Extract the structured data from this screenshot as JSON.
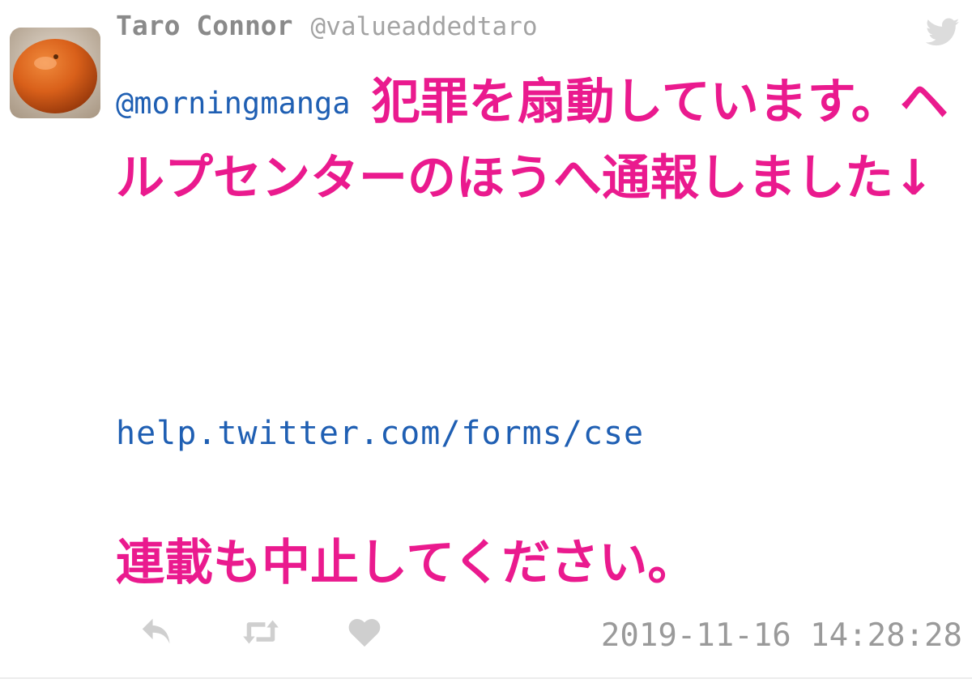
{
  "tweet": {
    "author_name": "Taro Connor",
    "author_handle": "@valueaddedtaro",
    "mention": "@morningmanga",
    "text_main": "犯罪を扇動しています。ヘルプセンターのほうへ通報しました↓",
    "link": "help.twitter.com/forms/cse",
    "text_final": "連載も中止してください。",
    "timestamp": "2019-11-16 14:28:28"
  },
  "icons": {
    "avatar": "persimmon-avatar",
    "brand": "twitter-bird-icon",
    "reply": "reply-icon",
    "retweet": "retweet-icon",
    "like": "heart-icon"
  },
  "colors": {
    "body_text": "#ea1a8e",
    "link": "#1f5fb3",
    "name": "#8a8a8a",
    "meta": "#9a9a9a",
    "icons": "#cfcfcf"
  }
}
